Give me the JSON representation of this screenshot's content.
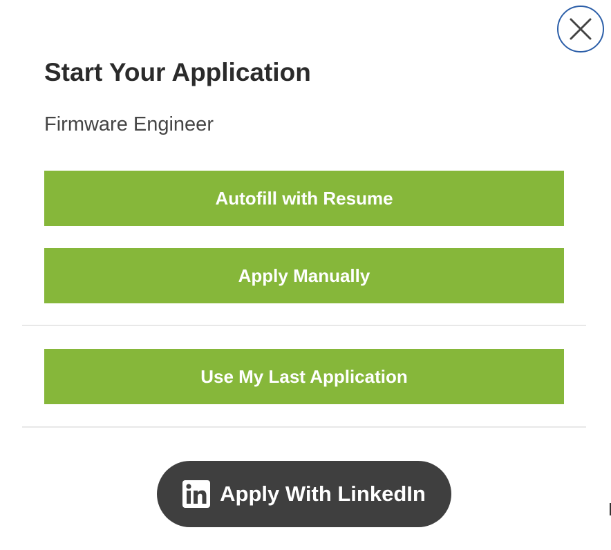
{
  "dialog": {
    "title": "Start Your Application",
    "job_title": "Firmware Engineer"
  },
  "buttons": {
    "autofill": "Autofill with Resume",
    "manual": "Apply Manually",
    "last_application": "Use My Last Application",
    "linkedin": "Apply With LinkedIn"
  },
  "icons": {
    "close": "close-icon",
    "linkedin": "linkedin-icon"
  },
  "colors": {
    "primary_button": "#86b73a",
    "linkedin_button": "#3f3f3f",
    "close_ring": "#2b5ea8",
    "title_text": "#2b2b2b"
  }
}
